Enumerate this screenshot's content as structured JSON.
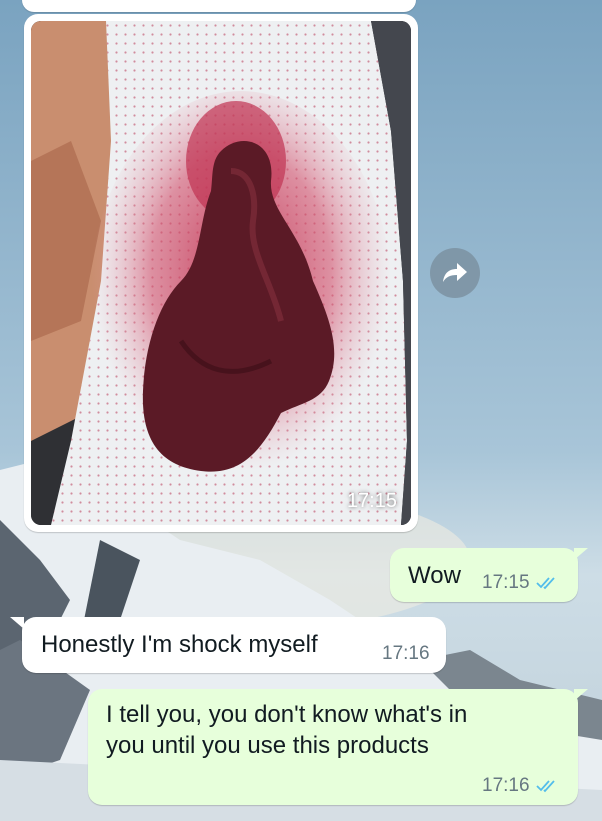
{
  "chat": {
    "image_message": {
      "time": "17:15"
    },
    "messages": [
      {
        "direction": "outgoing",
        "text": "Wow",
        "time": "17:15",
        "status_icon": "double-check-blue"
      },
      {
        "direction": "incoming",
        "text": "Honestly I'm shock myself",
        "time": "17:16"
      },
      {
        "direction": "outgoing",
        "text_lines": [
          "I tell you, you don't know what's in",
          "you until you use this products"
        ],
        "time": "17:16",
        "status_icon": "double-check-blue"
      }
    ]
  },
  "colors": {
    "outgoing_bubble": "#e7ffdb",
    "incoming_bubble": "#ffffff",
    "read_ticks": "#53bdeb",
    "meta_text": "#667781"
  },
  "icons": {
    "forward": "forward-arrow-icon"
  }
}
